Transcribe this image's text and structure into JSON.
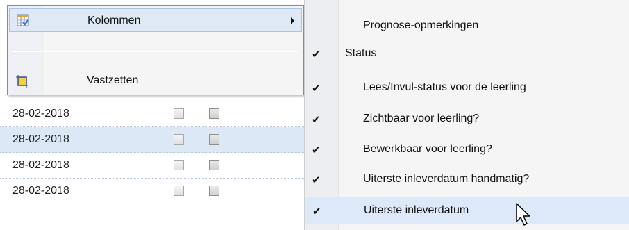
{
  "grid": {
    "rows": [
      {
        "date": "28-02-2018",
        "selected": false
      },
      {
        "date": "28-02-2018",
        "selected": true
      },
      {
        "date": "28-02-2018",
        "selected": false
      },
      {
        "date": "28-02-2018",
        "selected": false
      }
    ]
  },
  "context_menu": {
    "items": [
      {
        "label": "Kolommen",
        "icon": "columns-icon",
        "has_submenu": true
      },
      {
        "label": "Vastzetten",
        "icon": "freeze-icon"
      }
    ]
  },
  "submenu": {
    "items": [
      {
        "label": "Prognose-opmerkingen",
        "checked": false,
        "group": false
      },
      {
        "label": "Status",
        "checked": true,
        "group": true
      },
      {
        "label": "Lees/Invul-status voor de leerling",
        "checked": true,
        "group": false
      },
      {
        "label": "Zichtbaar voor leerling?",
        "checked": true,
        "group": false
      },
      {
        "label": "Bewerkbaar voor leerling?",
        "checked": true,
        "group": false
      },
      {
        "label": "Uiterste inleverdatum handmatig?",
        "checked": true,
        "group": false
      },
      {
        "label": "Uiterste inleverdatum",
        "checked": true,
        "group": false
      }
    ],
    "check_glyph": "✔"
  },
  "colors": {
    "highlight": "#dde9f8",
    "selected_row": "#dde8f7"
  }
}
